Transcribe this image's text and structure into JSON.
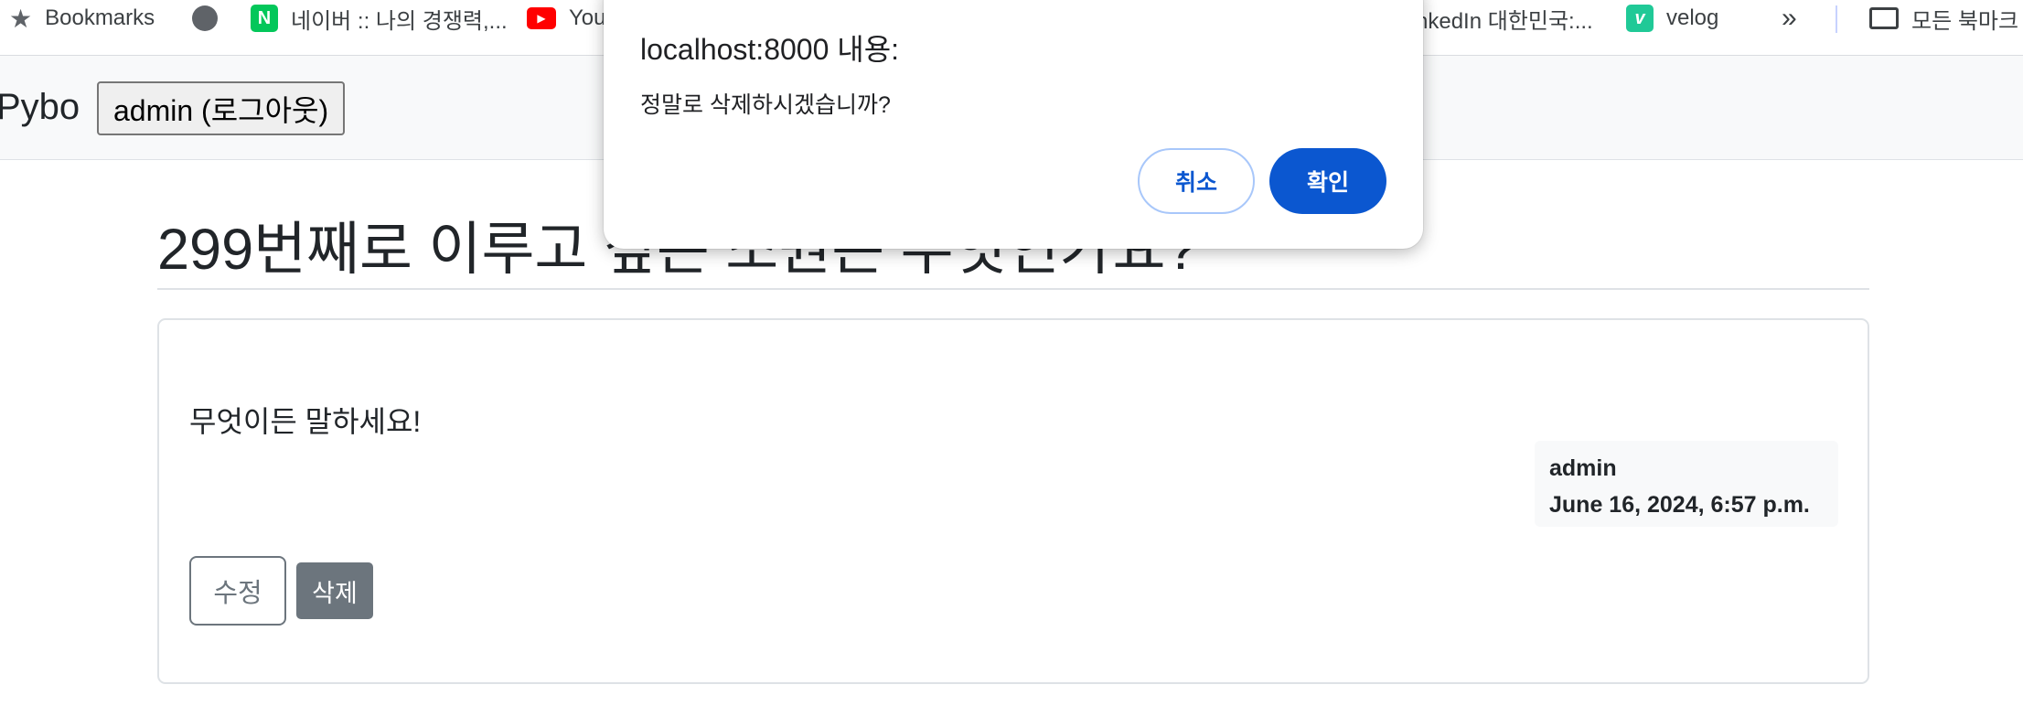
{
  "bookmarks_bar": {
    "items": [
      {
        "label": "Bookmarks",
        "icon": "star-icon"
      },
      {
        "label": "",
        "icon": "globe-icon"
      },
      {
        "label": "네이버 :: 나의 경쟁력,...",
        "icon": "naver-icon"
      },
      {
        "label": "You",
        "icon": "youtube-icon"
      },
      {
        "label": "nkedIn 대한민국:...",
        "icon": ""
      },
      {
        "label": "velog",
        "icon": "velog-icon"
      }
    ],
    "more_icon": "double-chevron-right-icon",
    "all_bookmarks_label": "모든 북마크",
    "colors": {
      "naver": "#03c75a",
      "youtube": "#ff0000",
      "velog": "#20c997"
    }
  },
  "navbar": {
    "brand": "Pybo",
    "user_button": "admin (로그아웃)"
  },
  "question": {
    "title": "299번째로 이루고 싶은 소원은 무엇인가요?",
    "content": "무엇이든 말하세요!",
    "author": "admin",
    "date": "June 16, 2024, 6:57 p.m.",
    "edit_label": "수정",
    "delete_label": "삭제"
  },
  "dialog": {
    "title": "localhost:8000 내용:",
    "message": "정말로 삭제하시겠습니까?",
    "cancel_label": "취소",
    "ok_label": "확인",
    "accent_color": "#0b57d0"
  }
}
